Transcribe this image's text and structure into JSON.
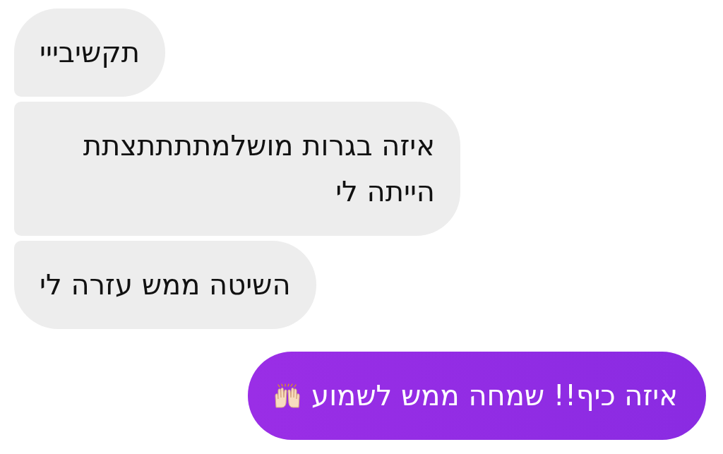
{
  "messages": [
    {
      "sent": false,
      "text": "תקשיבייי"
    },
    {
      "sent": false,
      "text": "איזה בגרות מושלמתתתתצתת הייתה לי"
    },
    {
      "sent": false,
      "text": "השיטה ממש עזרה לי"
    },
    {
      "sent": true,
      "text": "איזה כיף!! שמחה ממש לשמוע",
      "raised_hands": true
    }
  ]
}
